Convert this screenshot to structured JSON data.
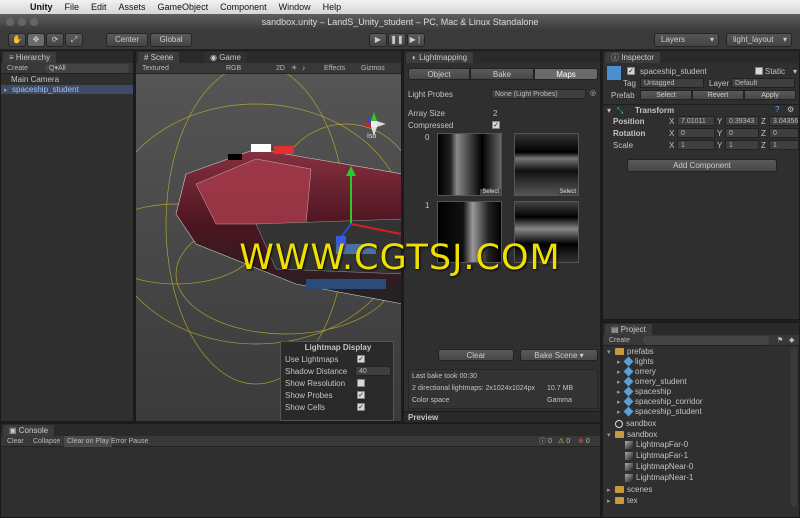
{
  "menubar": {
    "app": "Unity",
    "items": [
      "File",
      "Edit",
      "Assets",
      "GameObject",
      "Component",
      "Window",
      "Help"
    ]
  },
  "window_title": "sandbox.unity – LandS_Unity_student – PC, Mac & Linux Standalone",
  "toolbar": {
    "pivot": "Center",
    "space": "Global",
    "layers": "Layers",
    "layout": "light_layout"
  },
  "hierarchy": {
    "tab": "Hierarchy",
    "create": "Create",
    "search": "Q▾All",
    "items": [
      "Main Camera",
      "spaceship_student"
    ]
  },
  "scene": {
    "tab_scene": "Scene",
    "tab_game": "Game",
    "shading": "Textured",
    "render": "RGB",
    "mode2d": "2D",
    "effects": "Effects",
    "gizmos": "Gizmos",
    "gizmo_label": "Iso",
    "lightmap_display": {
      "title": "Lightmap Display",
      "use_lightmaps": "Use Lightmaps",
      "shadow_distance": "Shadow Distance",
      "shadow_value": "40",
      "show_resolution": "Show Resolution",
      "show_probes": "Show Probes",
      "show_cells": "Show Cells"
    }
  },
  "watermark": "WWW.CGTSJ.COM",
  "lightmapping": {
    "tab": "Lightmapping",
    "tabs": [
      "Object",
      "Bake",
      "Maps"
    ],
    "light_probes_label": "Light Probes",
    "light_probes_value": "None (Light Probes)",
    "array_size_label": "Array Size",
    "array_size_value": "2",
    "compressed_label": "Compressed",
    "row0": "0",
    "row1": "1",
    "select": "Select",
    "clear": "Clear",
    "bake_scene": "Bake Scene",
    "last_bake": "Last bake took 00:30",
    "maps_info": "2 directional lightmaps: 2x1024x1024px",
    "maps_size": "10.7 MB",
    "color_space_label": "Color space",
    "color_space_value": "Gamma",
    "preview": "Preview"
  },
  "inspector": {
    "tab": "Inspector",
    "object_name": "spaceship_student",
    "static": "Static",
    "tag_label": "Tag",
    "tag_value": "Untagged",
    "layer_label": "Layer",
    "layer_value": "Default",
    "prefab_label": "Prefab",
    "prefab_buttons": [
      "Select",
      "Revert",
      "Apply"
    ],
    "transform": "Transform",
    "position_label": "Position",
    "rotation_label": "Rotation",
    "scale_label": "Scale",
    "position": [
      "7.01011",
      "0.39343",
      "3.04356"
    ],
    "rotation": [
      "0",
      "0",
      "0"
    ],
    "scale": [
      "1",
      "1",
      "1"
    ],
    "add_component": "Add Component"
  },
  "project": {
    "tab": "Project",
    "create": "Create",
    "prefabs": "prefabs",
    "prefab_items": [
      "lights",
      "orrery",
      "orrery_student",
      "spaceship",
      "spaceship_corridor",
      "spaceship_student"
    ],
    "sandbox_scene": "sandbox",
    "sandbox_folder": "sandbox",
    "sandbox_items": [
      "LightmapFar-0",
      "LightmapFar-1",
      "LightmapNear-0",
      "LightmapNear-1"
    ],
    "scenes": "scenes",
    "tex": "tex"
  },
  "console": {
    "tab": "Console",
    "buttons": [
      "Clear",
      "Collapse",
      "Clear on Play",
      "Error Pause"
    ],
    "counts": [
      "0",
      "0",
      "0"
    ]
  }
}
